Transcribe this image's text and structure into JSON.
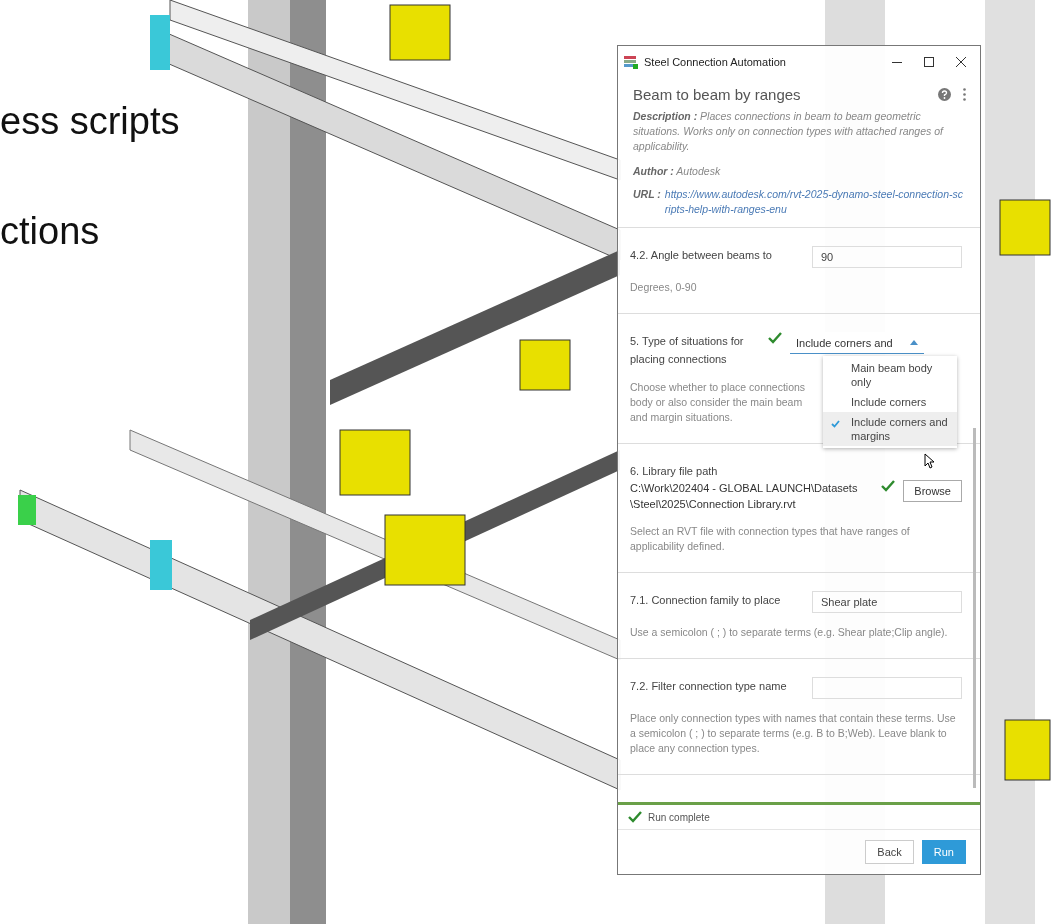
{
  "slide": {
    "lines": [
      "ess scripts",
      "ctions"
    ]
  },
  "window": {
    "title": "Steel Connection Automation"
  },
  "panel": {
    "title": "Beam to beam by ranges",
    "description": "**Description :** Places connections in beam to beam geometric situations. Works only on connection types with attached ranges of applicability.",
    "author": "**Author :** Autodesk",
    "url_label": "URL :",
    "url": "https://www.autodesk.com/rvt-2025-dynamo-steel-connection-scripts-help-with-ranges-enu"
  },
  "parameters": [
    {
      "kind": "text",
      "label": "4.2. Angle between beams to",
      "value": "90",
      "hint": "Degrees, 0-90"
    },
    {
      "kind": "dropdown",
      "label": "5. Type of situations for placing connections",
      "value": "Include corners and",
      "expanded": true,
      "valid": true,
      "hint": "Choose whether to place connections body or also consider the main beam and margin situations.",
      "options": [
        {
          "label": "Main beam body only",
          "selected": false
        },
        {
          "label": "Include corners",
          "selected": false
        },
        {
          "label": "Include corners and margins",
          "selected": true
        }
      ]
    },
    {
      "kind": "file",
      "label": "6. Library file path",
      "value": "C:\\Work\\202404 - GLOBAL LAUNCH\\Datasets \\Steel\\2025\\Connection Library.rvt",
      "button": "Browse",
      "valid": true,
      "hint": "Select an RVT file with connection types that have ranges of applicability defined."
    },
    {
      "kind": "text",
      "label": "7.1. Connection family to place",
      "value": "Shear plate",
      "hint": "Use a semicolon ( ; ) to separate terms (e.g. Shear plate;Clip angle)."
    },
    {
      "kind": "text",
      "label": "7.2. Filter connection type name",
      "hint": "Place only connection types with names that contain these terms. Use a semicolon ( ; ) to separate terms (e.g. B to B;Web). Leave blank to place any connection types."
    }
  ],
  "progress": {
    "level": 1
  },
  "status": "Run complete",
  "buttons": [
    {
      "label": "Back",
      "kind": "secondary"
    },
    {
      "label": "Run",
      "kind": "primary"
    }
  ]
}
